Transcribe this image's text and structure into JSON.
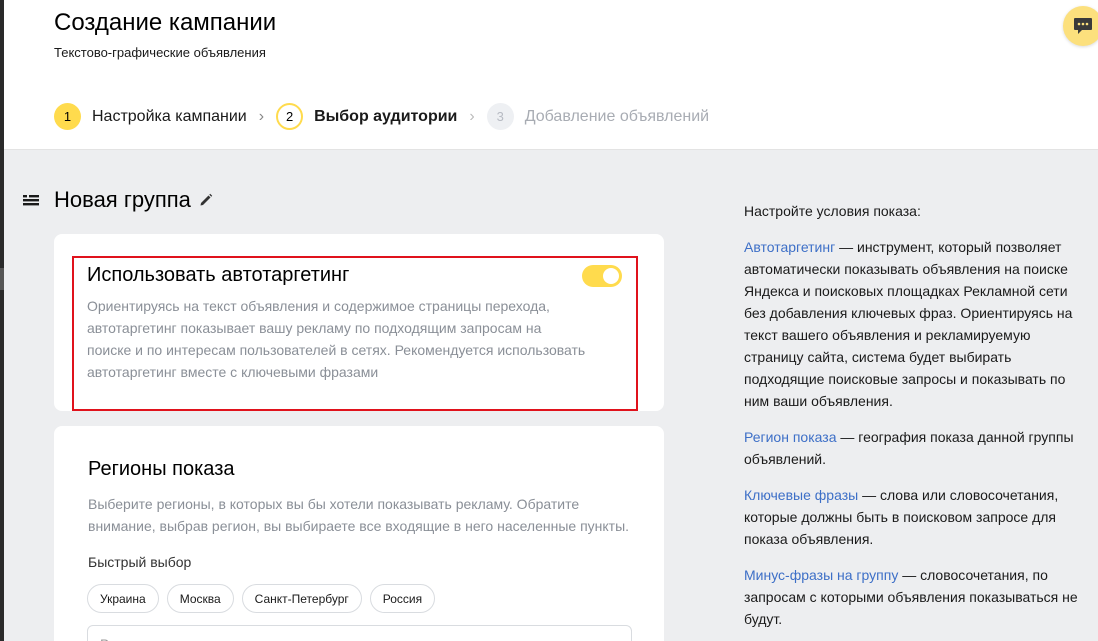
{
  "header": {
    "title": "Создание кампании",
    "subtitle": "Текстово-графические объявления"
  },
  "steps": [
    {
      "num": "1",
      "label": "Настройка кампании",
      "state": "done"
    },
    {
      "num": "2",
      "label": "Выбор аудитории",
      "state": "active"
    },
    {
      "num": "3",
      "label": "Добавление объявлений",
      "state": "todo"
    }
  ],
  "group": {
    "title": "Новая группа"
  },
  "autotargeting": {
    "title": "Использовать автотаргетинг",
    "enabled": true,
    "description": "Ориентируясь на текст объявления и содержимое страницы перехода, автотаргетинг показывает вашу рекламу по подходящим запросам на поиске и по интересам пользователей в сетях. Рекомендуется использовать автотаргетинг вместе с ключевыми фразами"
  },
  "regions": {
    "title": "Регионы показа",
    "description": "Выберите регионы, в которых вы бы хотели показывать рекламу. Обратите внимание, выбрав регион, вы выбираете все входящие в него населенные пункты.",
    "quick_label": "Быстрый выбор",
    "chips": [
      "Украина",
      "Москва",
      "Санкт-Петербург",
      "Россия"
    ],
    "input_placeholder": "В"
  },
  "sidebar": {
    "intro": "Настройте условия показа:",
    "items": [
      {
        "link": "Автотаргетинг",
        "text": " — инструмент, который позволяет автоматически показывать объявления на поиске Яндекса и поисковых площадках Рекламной сети без добавления ключевых фраз. Ориентируясь на текст вашего объявления и рекламируемую страницу сайта, система будет выбирать подходящие поисковые запросы и показывать по ним ваши объявления."
      },
      {
        "link": "Регион показа",
        "text": " — география показа данной группы объявлений."
      },
      {
        "link": "Ключевые фразы",
        "text": " — слова или словосочетания, которые должны быть в поисковом запросе для показа объявления."
      },
      {
        "link": "Минус-фразы на группу",
        "text": " — словосочетания, по запросам с которыми объявления показываться не будут."
      }
    ]
  },
  "colors": {
    "accent_yellow": "#ffdb4d",
    "highlight_red": "#e0121c",
    "link_blue": "#3d6fc7"
  }
}
